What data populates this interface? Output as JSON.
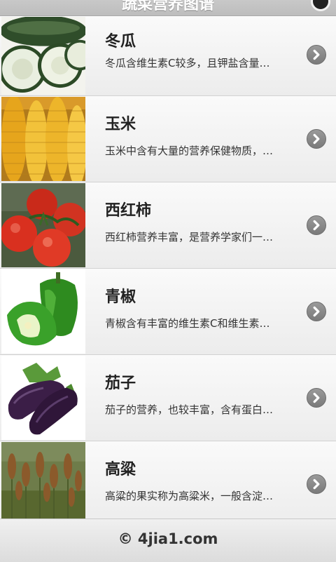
{
  "header": {
    "title": "蔬菜营养图谱"
  },
  "list": {
    "items": [
      {
        "image_icon": "winter-melon-image",
        "name": "冬瓜",
        "desc": "冬瓜含维生素C较多，且钾盐含量…"
      },
      {
        "image_icon": "corn-image",
        "name": "玉米",
        "desc": "玉米中含有大量的营养保健物质，…"
      },
      {
        "image_icon": "tomato-image",
        "name": "西红柿",
        "desc": "西红柿营养丰富，是营养学家们一…"
      },
      {
        "image_icon": "green-pepper-image",
        "name": "青椒",
        "desc": "青椒含有丰富的维生素C和维生素…"
      },
      {
        "image_icon": "eggplant-image",
        "name": "茄子",
        "desc": "茄子的营养，也较丰富，含有蛋白…"
      },
      {
        "image_icon": "sorghum-image",
        "name": "高粱",
        "desc": "高粱的果实称为高粱米，一般含淀…"
      }
    ],
    "chevron_icon": "chevron-right-icon"
  },
  "footer": {
    "copyright": "© 4jia1.com"
  }
}
